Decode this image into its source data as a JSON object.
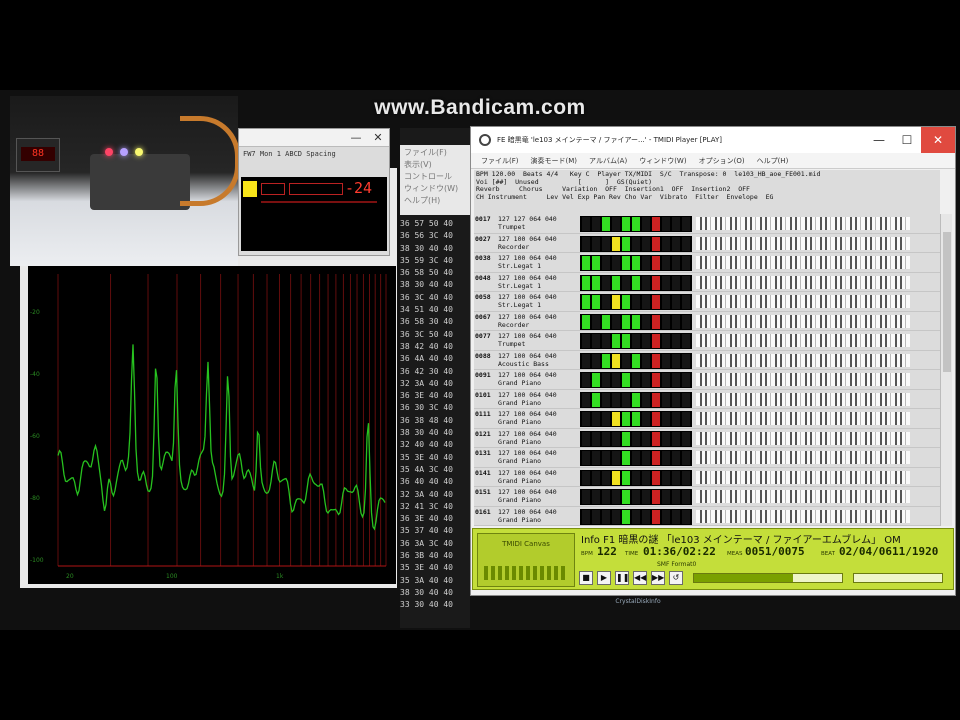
{
  "watermark": "www.Bandicam.com",
  "spectrum": {
    "y_ticks": [
      "-20",
      "-40",
      "-60",
      "-80",
      "-100"
    ],
    "x_ticks": [
      "20",
      "100",
      "1k"
    ]
  },
  "level_window": {
    "menu": "FW7 Mon 1 ABCD Spacing",
    "readout": "-24"
  },
  "hex_panel": {
    "menu_items": [
      "ファイル(F)",
      "表示(V)",
      "コントロール",
      "ウィンドウ(W)",
      "ヘルプ(H)"
    ],
    "rows": [
      "36 57 50 40",
      "36 56 3C 40",
      "38 30 40 40",
      "35 59 3C 40",
      "36 58 50 40",
      "38 30 40 40",
      "36 3C 40 40",
      "34 51 40 40",
      "36 58 30 40",
      "36 3C 50 40",
      "38 42 40 40",
      "36 4A 40 40",
      "36 42 30 40",
      "32 3A 40 40",
      "36 3E 40 40",
      "36 30 3C 40",
      "36 38 48 40",
      "38 30 40 40",
      "32 40 40 40",
      "35 3E 40 40",
      "35 4A 3C 40",
      "36 40 40 40",
      "32 3A 40 40",
      "32 41 3C 40",
      "36 3E 40 40",
      "35 37 40 40",
      "36 3A 3C 40",
      "36 3B 40 40",
      "35 3E 40 40",
      "35 3A 40 40",
      "38 30 40 40",
      "33 30 40 40"
    ]
  },
  "player": {
    "title": "FE 暗黒竜 'le103 メインテーマ / ファイアー...' - TMIDI Player [PLAY]",
    "window_buttons": [
      "—",
      "☐",
      "✕"
    ],
    "menus": [
      "ファイル(F)",
      "演奏モード(M)",
      "アルバム(A)",
      "ウィンドウ(W)",
      "オプション(O)",
      "ヘルプ(H)"
    ],
    "header_lines": [
      "BPM 120.00  Beats 4/4   Key C  Player TX/MIDI  S/C  Transpose: 0  le103_HB_aoe_FE001.mid",
      "Voi [##]  Unused          [      ]  GS(Quiet)",
      "Reverb     Chorus     Variation  OFF  Insertion1  OFF  Insertion2  OFF",
      "CH Instrument     Lev Vel Exp Pan Rev Cho Var  Vibrato  Filter  Envelope  EG"
    ],
    "tracks": [
      {
        "ch": "0017",
        "inst": "Trumpet",
        "vals": "127 127 064 040"
      },
      {
        "ch": "0027",
        "inst": "Recorder",
        "vals": "127 100 064 040"
      },
      {
        "ch": "0038",
        "inst": "Str.Legat 1",
        "vals": "127 100 064 040"
      },
      {
        "ch": "0048",
        "inst": "Str.Legat 1",
        "vals": "127 100 064 040"
      },
      {
        "ch": "0058",
        "inst": "Str.Legat 1",
        "vals": "127 100 064 040"
      },
      {
        "ch": "0067",
        "inst": "Recorder",
        "vals": "127 100 064 040"
      },
      {
        "ch": "0077",
        "inst": "Trumpet",
        "vals": "127 100 064 040"
      },
      {
        "ch": "0088",
        "inst": "Acoustic Bass",
        "vals": "127 100 064 040"
      },
      {
        "ch": "0091",
        "inst": "Grand Piano",
        "vals": "127 100 064 040"
      },
      {
        "ch": "0101",
        "inst": "Grand Piano",
        "vals": "127 100 064 040"
      },
      {
        "ch": "0111",
        "inst": "Grand Piano",
        "vals": "127 100 064 040"
      },
      {
        "ch": "0121",
        "inst": "Grand Piano",
        "vals": "127 100 064 040"
      },
      {
        "ch": "0131",
        "inst": "Grand Piano",
        "vals": "127 100 064 040"
      },
      {
        "ch": "0141",
        "inst": "Grand Piano",
        "vals": "127 100 064 040"
      },
      {
        "ch": "0151",
        "inst": "Grand Piano",
        "vals": "127 100 064 040"
      },
      {
        "ch": "0161",
        "inst": "Grand Piano",
        "vals": "127 100 064 040"
      }
    ]
  },
  "status": {
    "midi_box_label": "TMIDI Canvas",
    "song_title": "Info F1 暗黒の謎 「le103 メインテーマ / ファイアーエムブレム」 OM",
    "bpm_label": "BPM",
    "bpm": "122",
    "time_label": "TIME",
    "time": "01:36/02:22",
    "meas_label": "MEAS",
    "meas": "0051/0075",
    "beat_label": "BEAT",
    "beat": "02/04/0611/1920",
    "format": "SMF Format0",
    "controls": [
      "■",
      "▶",
      "❚❚",
      "◀◀",
      "▶▶",
      "↺"
    ]
  },
  "taskbar_tray": "CrystalDiskInfo",
  "colors": {
    "trace": "#27c21f",
    "grid": "#7a1010",
    "meter_green": "#33dd22",
    "meter_yellow": "#f0e020",
    "status_bg": "#c4de3a",
    "close_red": "#e04a3f"
  }
}
